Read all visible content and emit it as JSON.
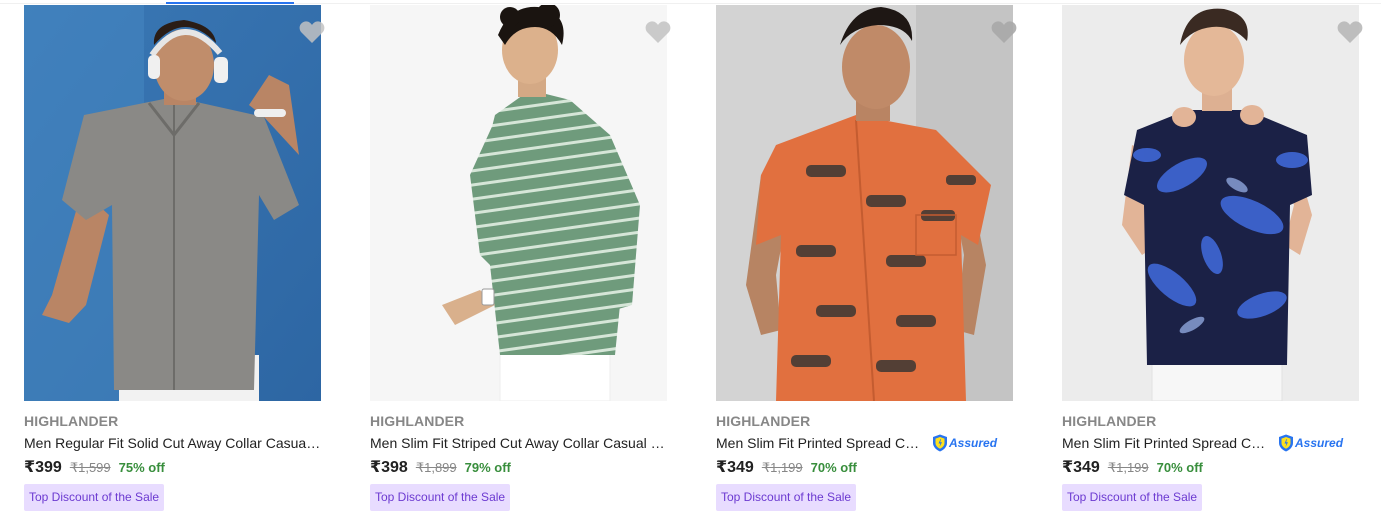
{
  "colors": {
    "accent": "#2874f0",
    "brand_text": "#878787",
    "discount_green": "#388e3c",
    "badge_bg": "#e8dcff",
    "badge_text": "#6c3ad1"
  },
  "products": [
    {
      "brand": "HIGHLANDER",
      "title": "Men Regular Fit Solid Cut Away Collar Casual Shirt",
      "price": "₹399",
      "mrp": "₹1,599",
      "discount": "75% off",
      "badge": "Top Discount of the Sale",
      "assured": false,
      "image": "grey-textured-shirt-blue-background",
      "wishlist_icon": "heart-icon"
    },
    {
      "brand": "HIGHLANDER",
      "title": "Men Slim Fit Striped Cut Away Collar Casual Shirt",
      "price": "₹398",
      "mrp": "₹1,899",
      "discount": "79% off",
      "badge": "Top Discount of the Sale",
      "assured": false,
      "image": "green-striped-shirt-white-background",
      "wishlist_icon": "heart-icon"
    },
    {
      "brand": "HIGHLANDER",
      "title": "Men Slim Fit Printed Spread Collar Casual Shirt",
      "price": "₹349",
      "mrp": "₹1,199",
      "discount": "70% off",
      "badge": "Top Discount of the Sale",
      "assured": true,
      "assured_label": "Assured",
      "image": "orange-car-print-shirt-grey-background",
      "wishlist_icon": "heart-icon"
    },
    {
      "brand": "HIGHLANDER",
      "title": "Men Slim Fit Printed Spread Collar Casual Shirt",
      "price": "₹349",
      "mrp": "₹1,199",
      "discount": "70% off",
      "badge": "Top Discount of the Sale",
      "assured": true,
      "assured_label": "Assured",
      "image": "navy-blue-floral-shirt-light-background",
      "wishlist_icon": "heart-icon"
    }
  ]
}
